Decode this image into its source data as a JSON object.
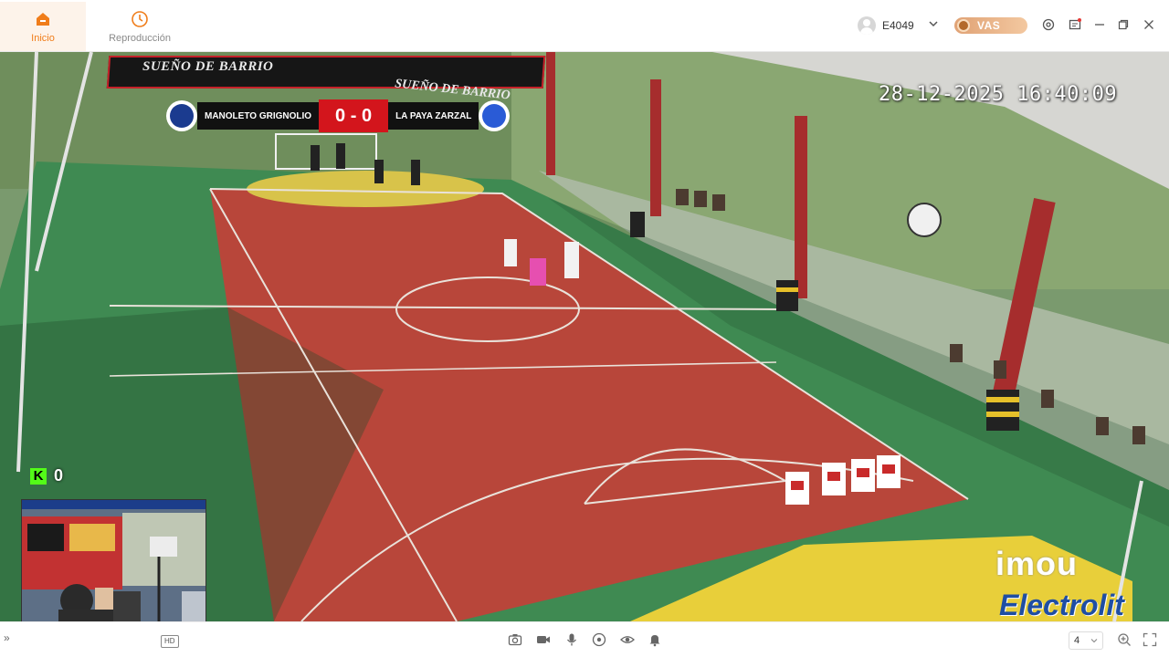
{
  "nav": {
    "tabs": [
      {
        "label": "Inicio",
        "icon": "home-icon",
        "active": true
      },
      {
        "label": "Reproducción",
        "icon": "clock-icon",
        "active": false
      }
    ]
  },
  "header": {
    "username": "E4049",
    "vas_label": "VAS",
    "icons": [
      "settings-icon",
      "message-icon",
      "minimize-icon",
      "restore-icon",
      "close-icon"
    ]
  },
  "video": {
    "timestamp": "28-12-2025 16:40:09",
    "scoreboard": {
      "home_team": "MANOLETO GRIGNOLIO",
      "score": "0 - 0",
      "away_team": "LA PAYA ZARZAL"
    },
    "banner_text": "SUEÑO DE BARRIO",
    "banner_text2": "SUEÑO DE BARRIO",
    "kick_label": "K",
    "kick_viewers": "0",
    "brand_imou": "imou",
    "brand_electrolit": "Electrolit"
  },
  "toolbar": {
    "hd_label": "HD",
    "grid_value": "4",
    "icons": [
      "screenshot-icon",
      "record-icon",
      "talk-icon",
      "ptz-icon",
      "view-icon",
      "alarm-icon"
    ]
  },
  "colors": {
    "accent": "#f07d1a",
    "court_red": "#b8463a",
    "court_green": "#3f8a52",
    "court_yellow": "#e8cf3a"
  }
}
